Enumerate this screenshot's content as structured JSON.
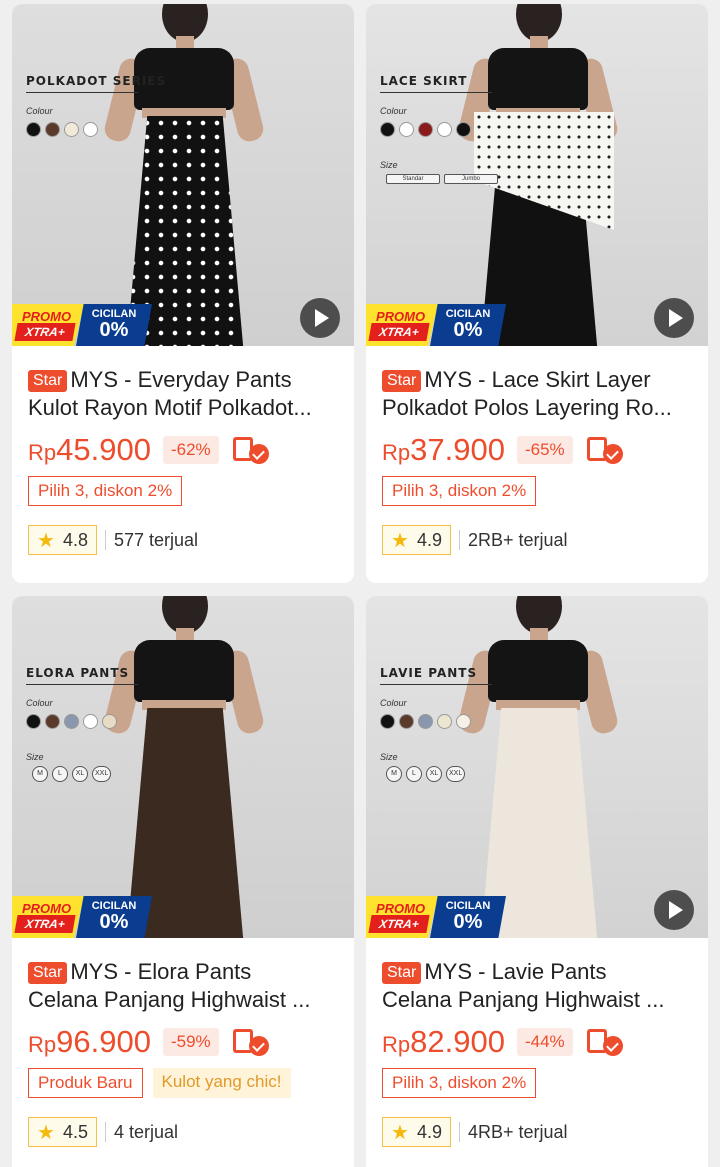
{
  "products": [
    {
      "series": "POLKADOT SERIES",
      "colour_label": "Colour",
      "swatches": [
        "#111111",
        "#5a3a2a",
        "#f2ead8",
        "#ffffff"
      ],
      "size_label": "",
      "sizes": [],
      "promo_1": "PROMO",
      "promo_2": "XTRA+",
      "promo_3": "CICILAN",
      "promo_4": "0%",
      "has_play": true,
      "badge": "Star",
      "title_1": "MYS -  Everyday Pants",
      "title_2": "Kulot Rayon Motif Polkadot...",
      "currency": "Rp",
      "price": "45.900",
      "discount": "-62%",
      "tags": [
        "Pilih 3, diskon 2%"
      ],
      "rating": "4.8",
      "sold": "577 terjual"
    },
    {
      "series": "LACE SKIRT",
      "colour_label": "Colour",
      "swatches": [
        "#111111",
        "#ffffff",
        "#8b1a1a",
        "#ffffff",
        "#111111"
      ],
      "size_label": "Size",
      "sizes": [
        "Standar",
        "Jumbo"
      ],
      "promo_1": "PROMO",
      "promo_2": "XTRA+",
      "promo_3": "CICILAN",
      "promo_4": "0%",
      "has_play": true,
      "badge": "Star",
      "title_1": "MYS - Lace Skirt Layer",
      "title_2": "Polkadot Polos Layering Ro...",
      "currency": "Rp",
      "price": "37.900",
      "discount": "-65%",
      "tags": [
        "Pilih 3, diskon 2%"
      ],
      "rating": "4.9",
      "sold": "2RB+ terjual"
    },
    {
      "series": "ELORA PANTS",
      "colour_label": "Colour",
      "swatches": [
        "#111111",
        "#5a3a2a",
        "#8a97ad",
        "#ffffff",
        "#e8dcc5"
      ],
      "size_label": "Size",
      "sizes": [
        "M",
        "L",
        "XL",
        "XXL"
      ],
      "promo_1": "PROMO",
      "promo_2": "XTRA+",
      "promo_3": "CICILAN",
      "promo_4": "0%",
      "has_play": false,
      "badge": "Star",
      "title_1": "MYS - Elora Pants",
      "title_2": "Celana Panjang Highwaist ...",
      "currency": "Rp",
      "price": "96.900",
      "discount": "-59%",
      "tags": [
        "Produk Baru",
        "Kulot yang chic!"
      ],
      "rating": "4.5",
      "sold": "4 terjual"
    },
    {
      "series": "LAVIE PANTS",
      "colour_label": "Colour",
      "swatches": [
        "#111111",
        "#5a3a2a",
        "#8a97ad",
        "#ece6d0",
        "#f5f1e6"
      ],
      "size_label": "Size",
      "sizes": [
        "M",
        "L",
        "XL",
        "XXL"
      ],
      "promo_1": "PROMO",
      "promo_2": "XTRA+",
      "promo_3": "CICILAN",
      "promo_4": "0%",
      "has_play": true,
      "badge": "Star",
      "title_1": "MYS - Lavie Pants",
      "title_2": "Celana Panjang Highwaist ...",
      "currency": "Rp",
      "price": "82.900",
      "discount": "-44%",
      "tags": [
        "Pilih 3, diskon 2%"
      ],
      "rating": "4.9",
      "sold": "4RB+ terjual"
    }
  ],
  "colors": {
    "accent": "#ee4d2d",
    "rating_star": "#f5b90e",
    "promo_yellow": "#ffe22e",
    "promo_blue": "#0a3d8f"
  }
}
